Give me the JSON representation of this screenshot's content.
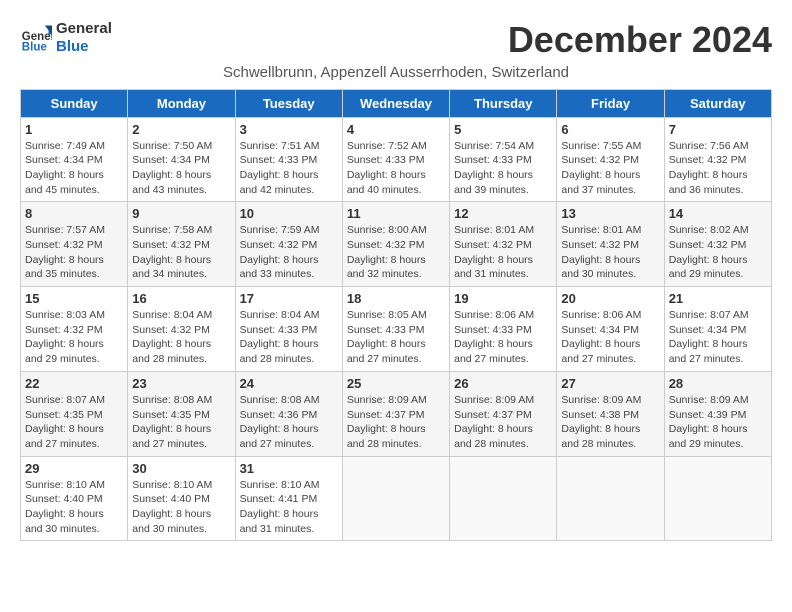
{
  "logo": {
    "line1": "General",
    "line2": "Blue"
  },
  "title": "December 2024",
  "subtitle": "Schwellbrunn, Appenzell Ausserrhoden, Switzerland",
  "days_of_week": [
    "Sunday",
    "Monday",
    "Tuesday",
    "Wednesday",
    "Thursday",
    "Friday",
    "Saturday"
  ],
  "weeks": [
    [
      {
        "day": "1",
        "sunrise": "7:49 AM",
        "sunset": "4:34 PM",
        "daylight": "8 hours and 45 minutes."
      },
      {
        "day": "2",
        "sunrise": "7:50 AM",
        "sunset": "4:34 PM",
        "daylight": "8 hours and 43 minutes."
      },
      {
        "day": "3",
        "sunrise": "7:51 AM",
        "sunset": "4:33 PM",
        "daylight": "8 hours and 42 minutes."
      },
      {
        "day": "4",
        "sunrise": "7:52 AM",
        "sunset": "4:33 PM",
        "daylight": "8 hours and 40 minutes."
      },
      {
        "day": "5",
        "sunrise": "7:54 AM",
        "sunset": "4:33 PM",
        "daylight": "8 hours and 39 minutes."
      },
      {
        "day": "6",
        "sunrise": "7:55 AM",
        "sunset": "4:32 PM",
        "daylight": "8 hours and 37 minutes."
      },
      {
        "day": "7",
        "sunrise": "7:56 AM",
        "sunset": "4:32 PM",
        "daylight": "8 hours and 36 minutes."
      }
    ],
    [
      {
        "day": "8",
        "sunrise": "7:57 AM",
        "sunset": "4:32 PM",
        "daylight": "8 hours and 35 minutes."
      },
      {
        "day": "9",
        "sunrise": "7:58 AM",
        "sunset": "4:32 PM",
        "daylight": "8 hours and 34 minutes."
      },
      {
        "day": "10",
        "sunrise": "7:59 AM",
        "sunset": "4:32 PM",
        "daylight": "8 hours and 33 minutes."
      },
      {
        "day": "11",
        "sunrise": "8:00 AM",
        "sunset": "4:32 PM",
        "daylight": "8 hours and 32 minutes."
      },
      {
        "day": "12",
        "sunrise": "8:01 AM",
        "sunset": "4:32 PM",
        "daylight": "8 hours and 31 minutes."
      },
      {
        "day": "13",
        "sunrise": "8:01 AM",
        "sunset": "4:32 PM",
        "daylight": "8 hours and 30 minutes."
      },
      {
        "day": "14",
        "sunrise": "8:02 AM",
        "sunset": "4:32 PM",
        "daylight": "8 hours and 29 minutes."
      }
    ],
    [
      {
        "day": "15",
        "sunrise": "8:03 AM",
        "sunset": "4:32 PM",
        "daylight": "8 hours and 29 minutes."
      },
      {
        "day": "16",
        "sunrise": "8:04 AM",
        "sunset": "4:32 PM",
        "daylight": "8 hours and 28 minutes."
      },
      {
        "day": "17",
        "sunrise": "8:04 AM",
        "sunset": "4:33 PM",
        "daylight": "8 hours and 28 minutes."
      },
      {
        "day": "18",
        "sunrise": "8:05 AM",
        "sunset": "4:33 PM",
        "daylight": "8 hours and 27 minutes."
      },
      {
        "day": "19",
        "sunrise": "8:06 AM",
        "sunset": "4:33 PM",
        "daylight": "8 hours and 27 minutes."
      },
      {
        "day": "20",
        "sunrise": "8:06 AM",
        "sunset": "4:34 PM",
        "daylight": "8 hours and 27 minutes."
      },
      {
        "day": "21",
        "sunrise": "8:07 AM",
        "sunset": "4:34 PM",
        "daylight": "8 hours and 27 minutes."
      }
    ],
    [
      {
        "day": "22",
        "sunrise": "8:07 AM",
        "sunset": "4:35 PM",
        "daylight": "8 hours and 27 minutes."
      },
      {
        "day": "23",
        "sunrise": "8:08 AM",
        "sunset": "4:35 PM",
        "daylight": "8 hours and 27 minutes."
      },
      {
        "day": "24",
        "sunrise": "8:08 AM",
        "sunset": "4:36 PM",
        "daylight": "8 hours and 27 minutes."
      },
      {
        "day": "25",
        "sunrise": "8:09 AM",
        "sunset": "4:37 PM",
        "daylight": "8 hours and 28 minutes."
      },
      {
        "day": "26",
        "sunrise": "8:09 AM",
        "sunset": "4:37 PM",
        "daylight": "8 hours and 28 minutes."
      },
      {
        "day": "27",
        "sunrise": "8:09 AM",
        "sunset": "4:38 PM",
        "daylight": "8 hours and 28 minutes."
      },
      {
        "day": "28",
        "sunrise": "8:09 AM",
        "sunset": "4:39 PM",
        "daylight": "8 hours and 29 minutes."
      }
    ],
    [
      {
        "day": "29",
        "sunrise": "8:10 AM",
        "sunset": "4:40 PM",
        "daylight": "8 hours and 30 minutes."
      },
      {
        "day": "30",
        "sunrise": "8:10 AM",
        "sunset": "4:40 PM",
        "daylight": "8 hours and 30 minutes."
      },
      {
        "day": "31",
        "sunrise": "8:10 AM",
        "sunset": "4:41 PM",
        "daylight": "8 hours and 31 minutes."
      },
      null,
      null,
      null,
      null
    ]
  ]
}
